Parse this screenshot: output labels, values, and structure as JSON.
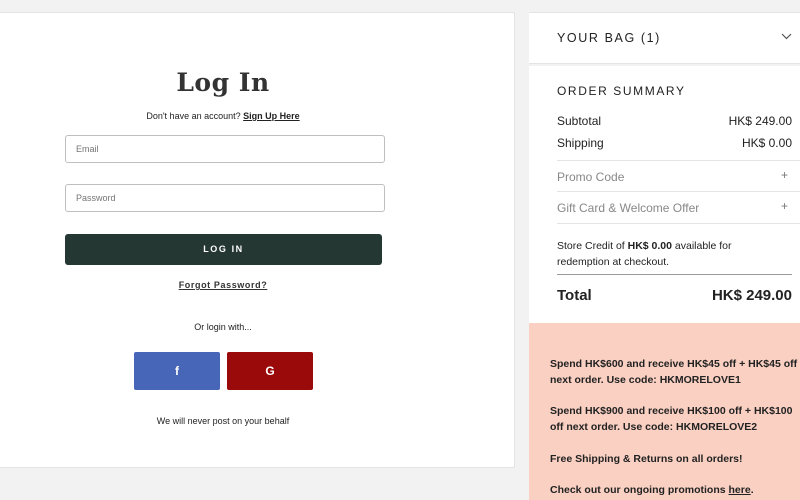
{
  "login": {
    "title": "Log In",
    "signup_prompt": "Don't have an account?",
    "signup_link": "Sign Up Here",
    "email_placeholder": "Email",
    "password_placeholder": "Password",
    "login_button": "LOG IN",
    "forgot_password": "Forgot Password?",
    "or_login_with": "Or login with...",
    "facebook_glyph": "f",
    "google_glyph": "G",
    "never_post": "We will never post on your behalf"
  },
  "bag": {
    "title": "YOUR BAG (1)"
  },
  "summary": {
    "title": "ORDER SUMMARY",
    "subtotal_label": "Subtotal",
    "subtotal_value": "HK$ 249.00",
    "shipping_label": "Shipping",
    "shipping_value": "HK$ 0.00",
    "promo_code_label": "Promo Code",
    "gift_card_label": "Gift Card & Welcome Offer",
    "store_credit_prefix": "Store Credit of",
    "store_credit_amount": "HK$ 0.00",
    "store_credit_suffix": "available for redemption at checkout.",
    "total_label": "Total",
    "total_value": "HK$ 249.00"
  },
  "promotions": {
    "promo_1": "Spend HK$600 and receive HK$45 off + HK$45 off next order. Use code: HKMORELOVE1",
    "promo_2": "Spend HK$900 and receive HK$100 off + HK$100 off next order. Use code: HKMORELOVE2",
    "promo_3": "Free Shipping & Returns on all orders!",
    "promo_4_prefix": "Check out our ongoing promotions",
    "promo_4_link": "here",
    "promo_4_suffix": "."
  },
  "colors": {
    "login_button": "#243733",
    "facebook": "#4866b7",
    "google": "#9b0a0a",
    "promo_background": "#f9d0c2"
  },
  "icons": {
    "bag_toggle": "chevron-down-icon",
    "promo_expand": "plus-icon",
    "gift_expand": "plus-icon"
  }
}
